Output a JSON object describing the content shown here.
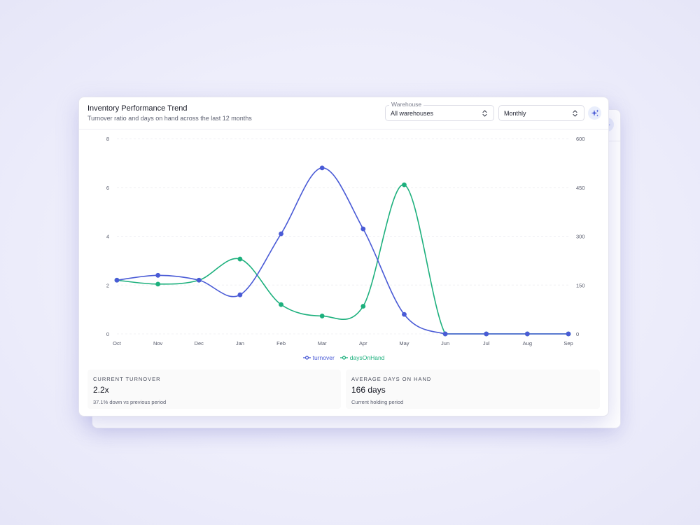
{
  "card": {
    "title": "Inventory Performance Trend",
    "subtitle": "Turnover ratio and days on hand across the last 12 months"
  },
  "controls": {
    "warehouse_label": "Warehouse",
    "warehouse_value": "All warehouses",
    "period_value": "Monthly",
    "action_icon": "sparkle-icon",
    "background_action_icon": "sparkle-icon"
  },
  "colors": {
    "turnover": "#4a5bd6",
    "daysOnHand": "#1db07d",
    "accent_bg": "#e9eefc",
    "grid": "#f0f0f4",
    "axis_text": "#55596a"
  },
  "chart_data": {
    "type": "line",
    "categories": [
      "Oct",
      "Nov",
      "Dec",
      "Jan",
      "Feb",
      "Mar",
      "Apr",
      "May",
      "Jun",
      "Jul",
      "Aug",
      "Sep"
    ],
    "series": [
      {
        "name": "turnover",
        "axis": "left",
        "values": [
          2.2,
          2.4,
          2.2,
          1.6,
          4.1,
          6.8,
          4.3,
          0.8,
          0,
          0,
          0,
          0
        ]
      },
      {
        "name": "daysOnHand",
        "axis": "right",
        "values": [
          165,
          153,
          165,
          230,
          90,
          55,
          85,
          458,
          0,
          0,
          0,
          0
        ]
      }
    ],
    "y_left": {
      "min": 0,
      "max": 8,
      "ticks": [
        "0",
        "2",
        "4",
        "6",
        "8"
      ]
    },
    "y_right": {
      "min": 0,
      "max": 600,
      "ticks": [
        "0",
        "150",
        "300",
        "450",
        "600"
      ]
    },
    "grid": true,
    "legend_position": "bottom-center"
  },
  "stats": {
    "turnover": {
      "label": "CURRENT TURNOVER",
      "value": "2.2x",
      "note": "37.1% down vs previous period"
    },
    "days": {
      "label": "AVERAGE DAYS ON HAND",
      "value": "166 days",
      "note": "Current holding period"
    }
  }
}
